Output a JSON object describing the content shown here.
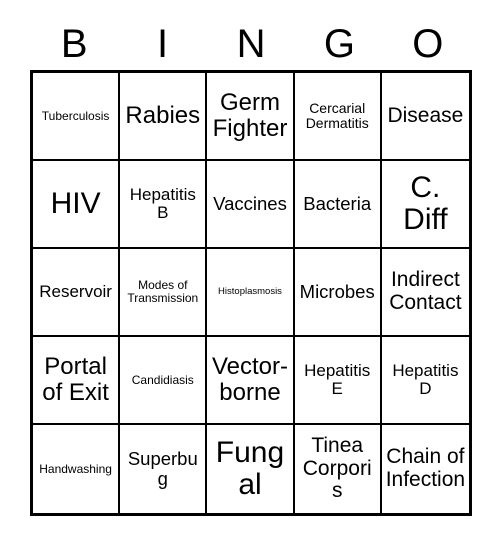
{
  "card": {
    "title_letters": [
      "B",
      "I",
      "N",
      "G",
      "O"
    ],
    "columns": 5,
    "rows": 5,
    "colors": {
      "background": "#ffffff",
      "text": "#000000",
      "border": "#000000"
    },
    "cells": [
      {
        "label": "Tuberculosis",
        "column": "B",
        "row": 1,
        "size": "xs"
      },
      {
        "label": "Rabies",
        "column": "I",
        "row": 1,
        "size": "xl"
      },
      {
        "label": "Germ Fighter",
        "column": "N",
        "row": 1,
        "size": "xl"
      },
      {
        "label": "Cercarial Dermatitis",
        "column": "G",
        "row": 1,
        "size": "s"
      },
      {
        "label": "Disease",
        "column": "O",
        "row": 1,
        "size": "l"
      },
      {
        "label": "HIV",
        "column": "B",
        "row": 2,
        "size": "xxl"
      },
      {
        "label": "Hepatitis B",
        "column": "I",
        "row": 2,
        "size": "m"
      },
      {
        "label": "Vaccines",
        "column": "N",
        "row": 2,
        "size": "ml"
      },
      {
        "label": "Bacteria",
        "column": "G",
        "row": 2,
        "size": "ml"
      },
      {
        "label": "C. Diff",
        "column": "O",
        "row": 2,
        "size": "xxl"
      },
      {
        "label": "Reservoir",
        "column": "B",
        "row": 3,
        "size": "m"
      },
      {
        "label": "Modes of Transmission",
        "column": "I",
        "row": 3,
        "size": "xs"
      },
      {
        "label": "Histoplasmosis",
        "column": "N",
        "row": 3,
        "size": "xxs"
      },
      {
        "label": "Microbes",
        "column": "G",
        "row": 3,
        "size": "ml"
      },
      {
        "label": "Indirect Contact",
        "column": "O",
        "row": 3,
        "size": "l"
      },
      {
        "label": "Portal of Exit",
        "column": "B",
        "row": 4,
        "size": "xl"
      },
      {
        "label": "Candidiasis",
        "column": "I",
        "row": 4,
        "size": "xs"
      },
      {
        "label": "Vector-borne",
        "column": "N",
        "row": 4,
        "size": "xl"
      },
      {
        "label": "Hepatitis E",
        "column": "G",
        "row": 4,
        "size": "m"
      },
      {
        "label": "Hepatitis D",
        "column": "O",
        "row": 4,
        "size": "m"
      },
      {
        "label": "Handwashing",
        "column": "B",
        "row": 5,
        "size": "xs"
      },
      {
        "label": "Superbug",
        "column": "I",
        "row": 5,
        "size": "ml"
      },
      {
        "label": "Fungal",
        "column": "N",
        "row": 5,
        "size": "xxl"
      },
      {
        "label": "Tinea Corporis",
        "column": "G",
        "row": 5,
        "size": "l"
      },
      {
        "label": "Chain of Infection",
        "column": "O",
        "row": 5,
        "size": "l"
      }
    ]
  }
}
